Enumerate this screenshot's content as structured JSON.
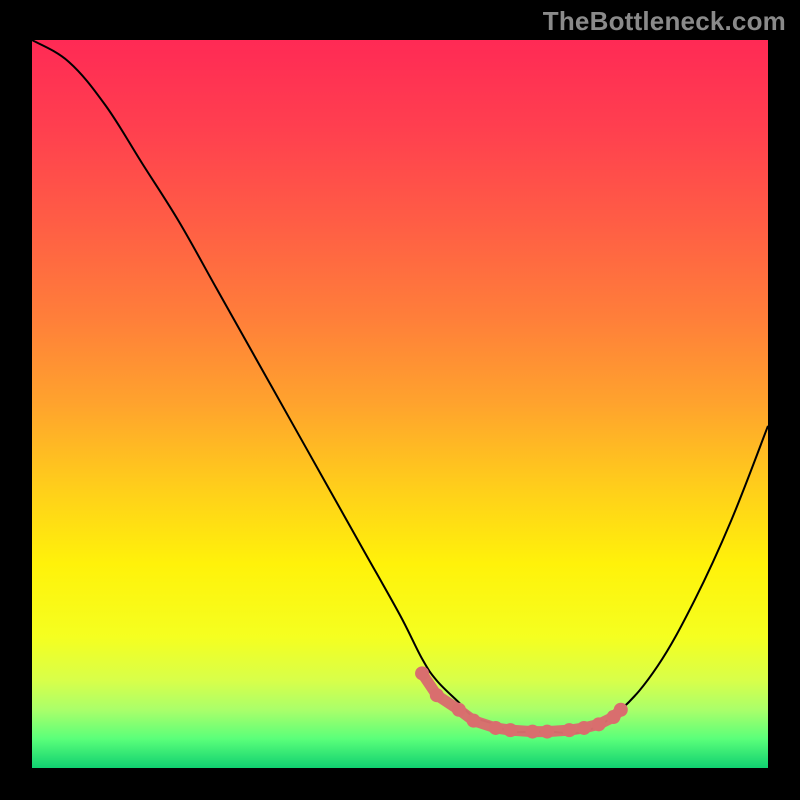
{
  "watermark": {
    "label": "TheBottleneck.com"
  },
  "chart_data": {
    "type": "line",
    "title": "",
    "xlabel": "",
    "ylabel": "",
    "xlim": [
      0,
      100
    ],
    "ylim": [
      0,
      100
    ],
    "series": [
      {
        "name": "bottleneck-curve",
        "x": [
          0,
          5,
          10,
          15,
          20,
          25,
          30,
          35,
          40,
          45,
          50,
          53,
          55,
          58,
          60,
          63,
          65,
          70,
          75,
          80,
          85,
          90,
          95,
          100
        ],
        "values": [
          100,
          97,
          91,
          83,
          75,
          66,
          57,
          48,
          39,
          30,
          21,
          15,
          12,
          9,
          7,
          6,
          5,
          5,
          5,
          8,
          14,
          23,
          34,
          47
        ]
      }
    ],
    "markers": {
      "name": "highlight-dots",
      "color": "#d96e6e",
      "points_x": [
        53,
        55,
        58,
        60,
        63,
        65,
        68,
        70,
        73,
        75,
        77,
        79,
        80
      ],
      "points_y": [
        13,
        10,
        8,
        6.5,
        5.5,
        5.2,
        5,
        5,
        5.2,
        5.5,
        6,
        7,
        8
      ]
    },
    "gradient_stops": [
      {
        "offset": 0.0,
        "color": "#ff2a55"
      },
      {
        "offset": 0.12,
        "color": "#ff3f4f"
      },
      {
        "offset": 0.25,
        "color": "#ff5d45"
      },
      {
        "offset": 0.38,
        "color": "#ff7e3a"
      },
      {
        "offset": 0.5,
        "color": "#ffa32d"
      },
      {
        "offset": 0.62,
        "color": "#ffd01a"
      },
      {
        "offset": 0.72,
        "color": "#fff20a"
      },
      {
        "offset": 0.82,
        "color": "#f5ff20"
      },
      {
        "offset": 0.88,
        "color": "#d8ff4a"
      },
      {
        "offset": 0.92,
        "color": "#aaff6a"
      },
      {
        "offset": 0.96,
        "color": "#5aff7a"
      },
      {
        "offset": 1.0,
        "color": "#10d070"
      }
    ]
  }
}
